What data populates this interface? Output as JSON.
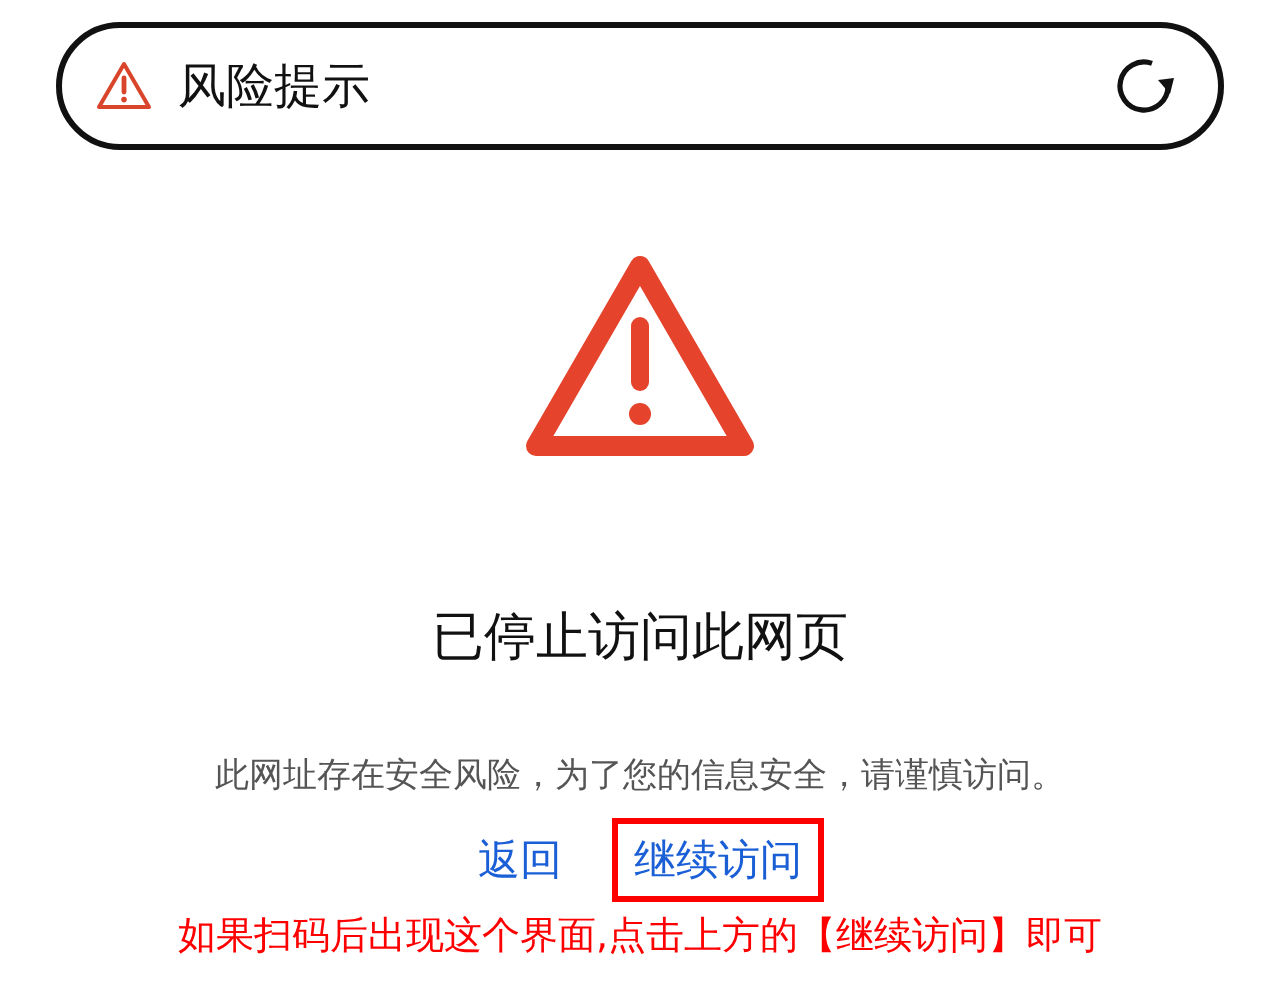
{
  "address_bar": {
    "title": "风险提示"
  },
  "heading": "已停止访问此网页",
  "message": "此网址存在安全风险，为了您的信息安全，请谨慎访问。",
  "links": [
    {
      "label": "返回",
      "highlighted": false
    },
    {
      "label": "继续访问",
      "highlighted": true
    }
  ],
  "annotation": "如果扫码后出现这个界面,点击上方的【继续访问】即可"
}
